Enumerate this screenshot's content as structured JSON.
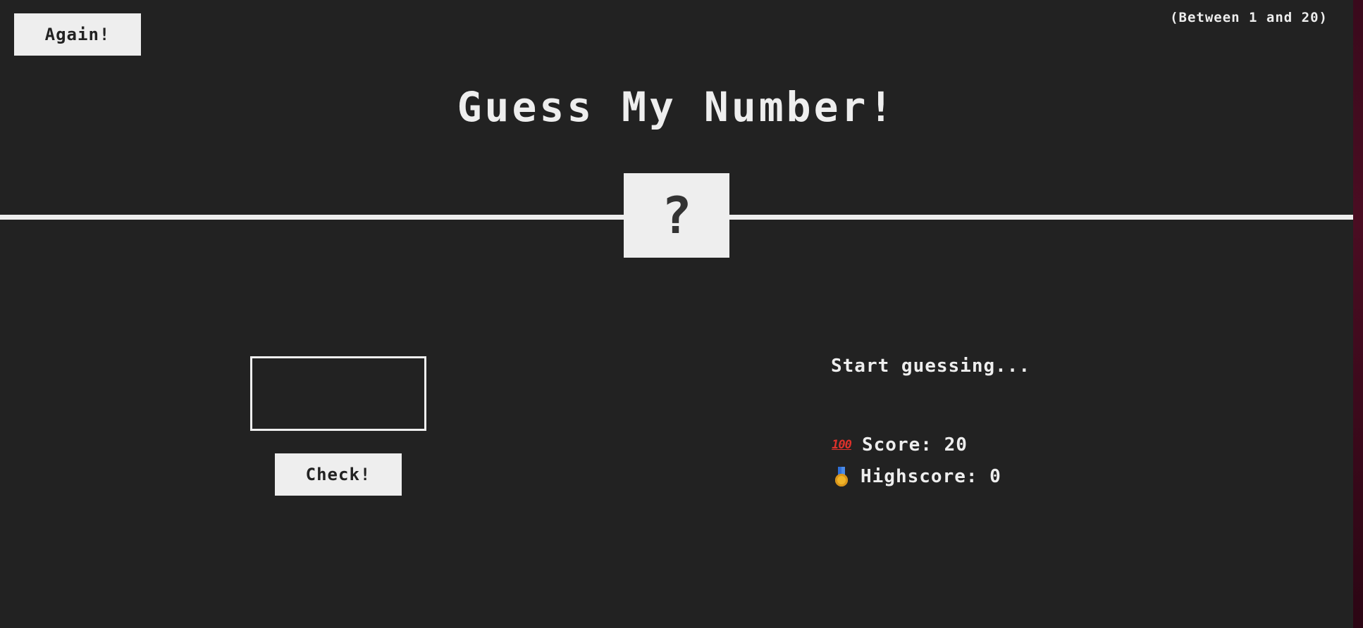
{
  "header": {
    "again_label": "Again!",
    "range_text": "(Between 1 and 20)",
    "title": "Guess My Number!"
  },
  "secret": {
    "display": "?"
  },
  "left": {
    "guess_value": "",
    "check_label": "Check!"
  },
  "right": {
    "message": "Start guessing...",
    "score_icon": "hundred-points-icon",
    "score_icon_glyph": "100",
    "score_label": "Score: 20",
    "highscore_icon": "medal-icon",
    "highscore_label": "Highscore: 0"
  },
  "colors": {
    "background": "#222222",
    "foreground": "#eeeeee",
    "accent_red": "#e0312b",
    "medal_gold": "#f0b429",
    "medal_ribbon": "#2f6fd6"
  }
}
